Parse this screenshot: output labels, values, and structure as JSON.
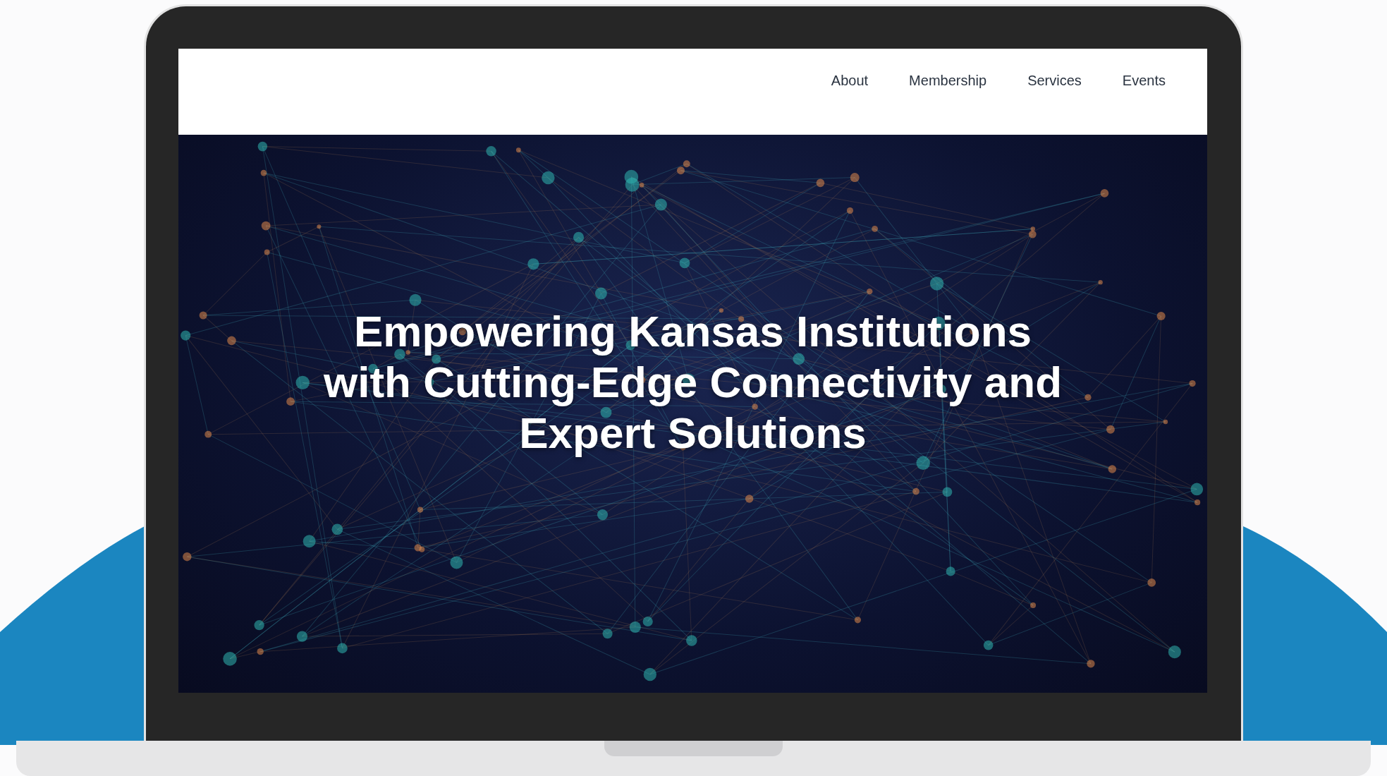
{
  "nav": {
    "links": [
      {
        "label": "About"
      },
      {
        "label": "Membership"
      },
      {
        "label": "Services"
      },
      {
        "label": "Events"
      }
    ]
  },
  "hero": {
    "heading": "Empowering Kansas Institutions with Cutting-Edge Connectivity and Expert Solutions"
  }
}
